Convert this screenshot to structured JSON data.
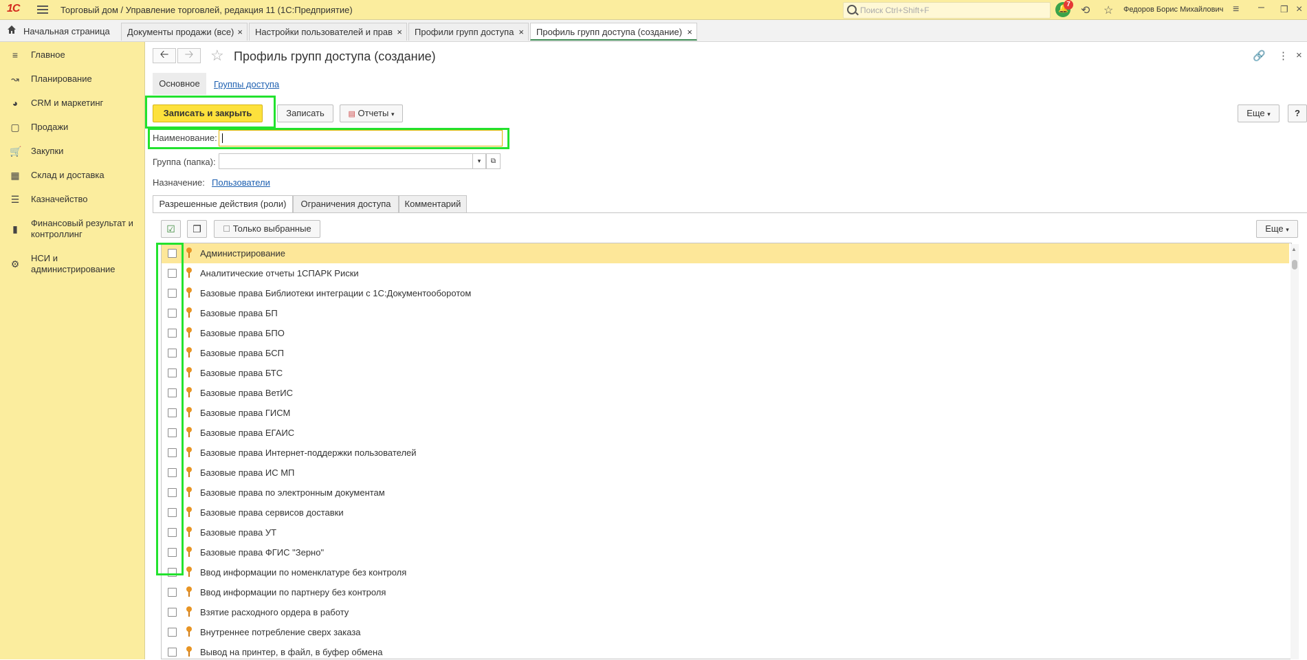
{
  "app": {
    "logo": "1С",
    "window_title": "Торговый дом / Управление торговлей, редакция 11  (1С:Предприятие)",
    "search_placeholder": "Поиск Ctrl+Shift+F",
    "notifications_count": "7",
    "user_name": "Федоров Борис Михайлович"
  },
  "tabs": [
    {
      "label": "Начальная страница"
    },
    {
      "label": "Документы продажи (все)"
    },
    {
      "label": "Настройки пользователей и прав"
    },
    {
      "label": "Профили групп доступа"
    },
    {
      "label": "Профиль групп доступа (создание)"
    }
  ],
  "sidebar": {
    "items": [
      {
        "label": "Главное",
        "icon": "menu-icon"
      },
      {
        "label": "Планирование",
        "icon": "planning-icon"
      },
      {
        "label": "CRM и маркетинг",
        "icon": "pie-chart-icon"
      },
      {
        "label": "Продажи",
        "icon": "bag-icon"
      },
      {
        "label": "Закупки",
        "icon": "cart-icon"
      },
      {
        "label": "Склад и доставка",
        "icon": "warehouse-icon"
      },
      {
        "label": "Казначейство",
        "icon": "coins-icon"
      },
      {
        "label": "Финансовый результат и контроллинг",
        "icon": "bar-chart-icon"
      },
      {
        "label": "НСИ и администрирование",
        "icon": "gear-icon"
      }
    ]
  },
  "form": {
    "title": "Профиль групп доступа (создание)",
    "subtab_main": "Основное",
    "subtab_groups": "Группы доступа",
    "btn_save_close": "Записать и закрыть",
    "btn_save": "Записать",
    "btn_reports": "Отчеты",
    "btn_more": "Еще",
    "btn_help": "?",
    "name_label": "Наименование:",
    "name_value": "",
    "group_label": "Группа (папка):",
    "group_value": "",
    "purpose_label": "Назначение:",
    "purpose_value": "Пользователи"
  },
  "inner_tabs": [
    {
      "label": "Разрешенные действия (роли)"
    },
    {
      "label": "Ограничения доступа"
    },
    {
      "label": "Комментарий"
    }
  ],
  "roles_toolbar": {
    "only_selected": "Только выбранные",
    "more": "Еще"
  },
  "roles": [
    {
      "label": "Администрирование",
      "checked": false,
      "selected": true
    },
    {
      "label": "Аналитические отчеты 1СПАРК Риски",
      "checked": false
    },
    {
      "label": "Базовые права Библиотеки интеграции с 1С:Документооборотом",
      "checked": false
    },
    {
      "label": "Базовые права БП",
      "checked": false
    },
    {
      "label": "Базовые права БПО",
      "checked": false
    },
    {
      "label": "Базовые права БСП",
      "checked": false
    },
    {
      "label": "Базовые права БТС",
      "checked": false
    },
    {
      "label": "Базовые права ВетИС",
      "checked": false
    },
    {
      "label": "Базовые права ГИСМ",
      "checked": false
    },
    {
      "label": "Базовые права ЕГАИС",
      "checked": false
    },
    {
      "label": "Базовые права Интернет-поддержки пользователей",
      "checked": false
    },
    {
      "label": "Базовые права ИС МП",
      "checked": false
    },
    {
      "label": "Базовые права по электронным документам",
      "checked": false
    },
    {
      "label": "Базовые права сервисов доставки",
      "checked": false
    },
    {
      "label": "Базовые права УТ",
      "checked": false
    },
    {
      "label": "Базовые права ФГИС \"Зерно\"",
      "checked": false
    },
    {
      "label": "Ввод информации по номенклатуре без контроля",
      "checked": false
    },
    {
      "label": "Ввод информации по партнеру без контроля",
      "checked": false
    },
    {
      "label": "Взятие расходного ордера в работу",
      "checked": false
    },
    {
      "label": "Внутреннее потребление сверх заказа",
      "checked": false
    },
    {
      "label": "Вывод на принтер, в файл, в буфер обмена",
      "checked": false
    }
  ],
  "colors": {
    "panel_yellow": "#fbed9e",
    "primary_button": "#fde13c",
    "highlight_green": "#22e22e",
    "selected_row": "#fde799",
    "link": "#1c5fb0"
  }
}
